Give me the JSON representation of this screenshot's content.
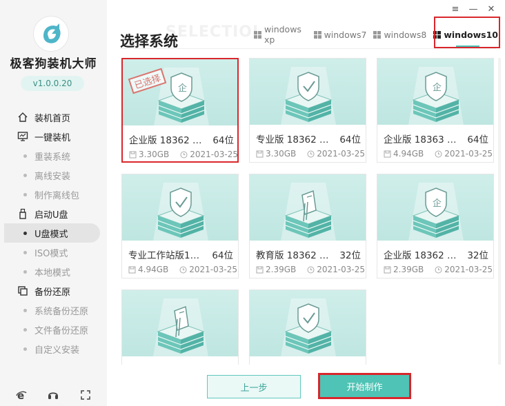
{
  "app": {
    "title": "极客狗装机大师",
    "version": "v1.0.0.20"
  },
  "window_controls": {
    "menu": "≡",
    "minimize": "—",
    "close": "✕"
  },
  "nav": [
    {
      "label": "装机首页",
      "icon": "home-icon",
      "type": "main"
    },
    {
      "label": "一键装机",
      "icon": "monitor-icon",
      "type": "main"
    },
    {
      "label": "重装系统",
      "type": "sub"
    },
    {
      "label": "离线安装",
      "type": "sub"
    },
    {
      "label": "制作离线包",
      "type": "sub"
    },
    {
      "label": "启动U盘",
      "icon": "usb-icon",
      "type": "main"
    },
    {
      "label": "U盘模式",
      "type": "sub",
      "active": true
    },
    {
      "label": "ISO模式",
      "type": "sub"
    },
    {
      "label": "本地模式",
      "type": "sub"
    },
    {
      "label": "备份还原",
      "icon": "backup-icon",
      "type": "main"
    },
    {
      "label": "系统备份还原",
      "type": "sub"
    },
    {
      "label": "文件备份还原",
      "type": "sub"
    },
    {
      "label": "自定义安装",
      "type": "sub"
    }
  ],
  "page": {
    "title": "选择系统",
    "watermark": "SELECTIOI"
  },
  "tabs": [
    {
      "label": "windows xp",
      "active": false
    },
    {
      "label": "windows7",
      "active": false
    },
    {
      "label": "windows8",
      "active": false
    },
    {
      "label": "windows10",
      "active": true
    }
  ],
  "cards": [
    {
      "name": "企业版 18362 19...",
      "bits": "64位",
      "size": "3.30GB",
      "date": "2021-03-25",
      "selected": true,
      "stamp": "已选择",
      "icon": "shield-icon"
    },
    {
      "name": "专业版 18362 19...",
      "bits": "64位",
      "size": "3.30GB",
      "date": "2021-03-25",
      "selected": false,
      "icon": "shield-check-icon"
    },
    {
      "name": "企业版 18363 19...",
      "bits": "64位",
      "size": "4.94GB",
      "date": "2021-03-25",
      "selected": false,
      "icon": "shield-icon"
    },
    {
      "name": "专业工作站版183...",
      "bits": "64位",
      "size": "4.94GB",
      "date": "2021-03-25",
      "selected": false,
      "icon": "shield-check-icon"
    },
    {
      "name": "教育版 18362 19...",
      "bits": "32位",
      "size": "2.39GB",
      "date": "2021-03-25",
      "selected": false,
      "icon": "book-icon"
    },
    {
      "name": "企业版 18362 19...",
      "bits": "32位",
      "size": "2.39GB",
      "date": "2021-03-25",
      "selected": false,
      "icon": "shield-icon"
    },
    {
      "name": "",
      "bits": "",
      "size": "",
      "date": "",
      "selected": false,
      "icon": "book-icon"
    },
    {
      "name": "",
      "bits": "",
      "size": "",
      "date": "",
      "selected": false,
      "icon": "shield-check-icon"
    }
  ],
  "buttons": {
    "prev": "上一步",
    "start": "开始制作"
  },
  "colors": {
    "accent": "#4fc3b5",
    "highlight": "#d9262b",
    "sidebar": "#f5f5f5"
  }
}
